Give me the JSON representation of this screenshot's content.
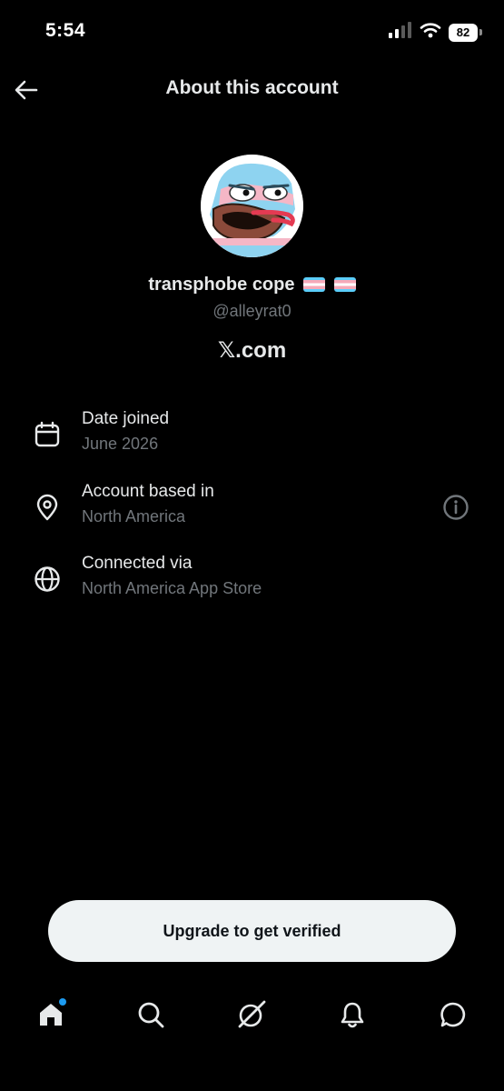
{
  "status_bar": {
    "time": "5:54",
    "battery_level": "82"
  },
  "header": {
    "title": "About this account"
  },
  "profile": {
    "display_name": "transphobe cope",
    "handle": "@alleyrat0",
    "site": "𝕏.com"
  },
  "details": [
    {
      "icon": "calendar-icon",
      "label": "Date joined",
      "value": "June 2026"
    },
    {
      "icon": "location-pin-icon",
      "label": "Account based in",
      "value": "North America"
    },
    {
      "icon": "globe-icon",
      "label": "Connected via",
      "value": "North America App Store"
    }
  ],
  "upgrade_button": {
    "label": "Upgrade to get verified"
  },
  "bottom_nav": [
    "home-icon",
    "search-icon",
    "grok-icon",
    "bell-icon",
    "messages-icon"
  ],
  "colors": {
    "background": "#000000",
    "primary_text": "#e7e9ea",
    "secondary_text": "#71767b",
    "accent": "#1d9bf0",
    "button_bg": "#eff3f4"
  }
}
